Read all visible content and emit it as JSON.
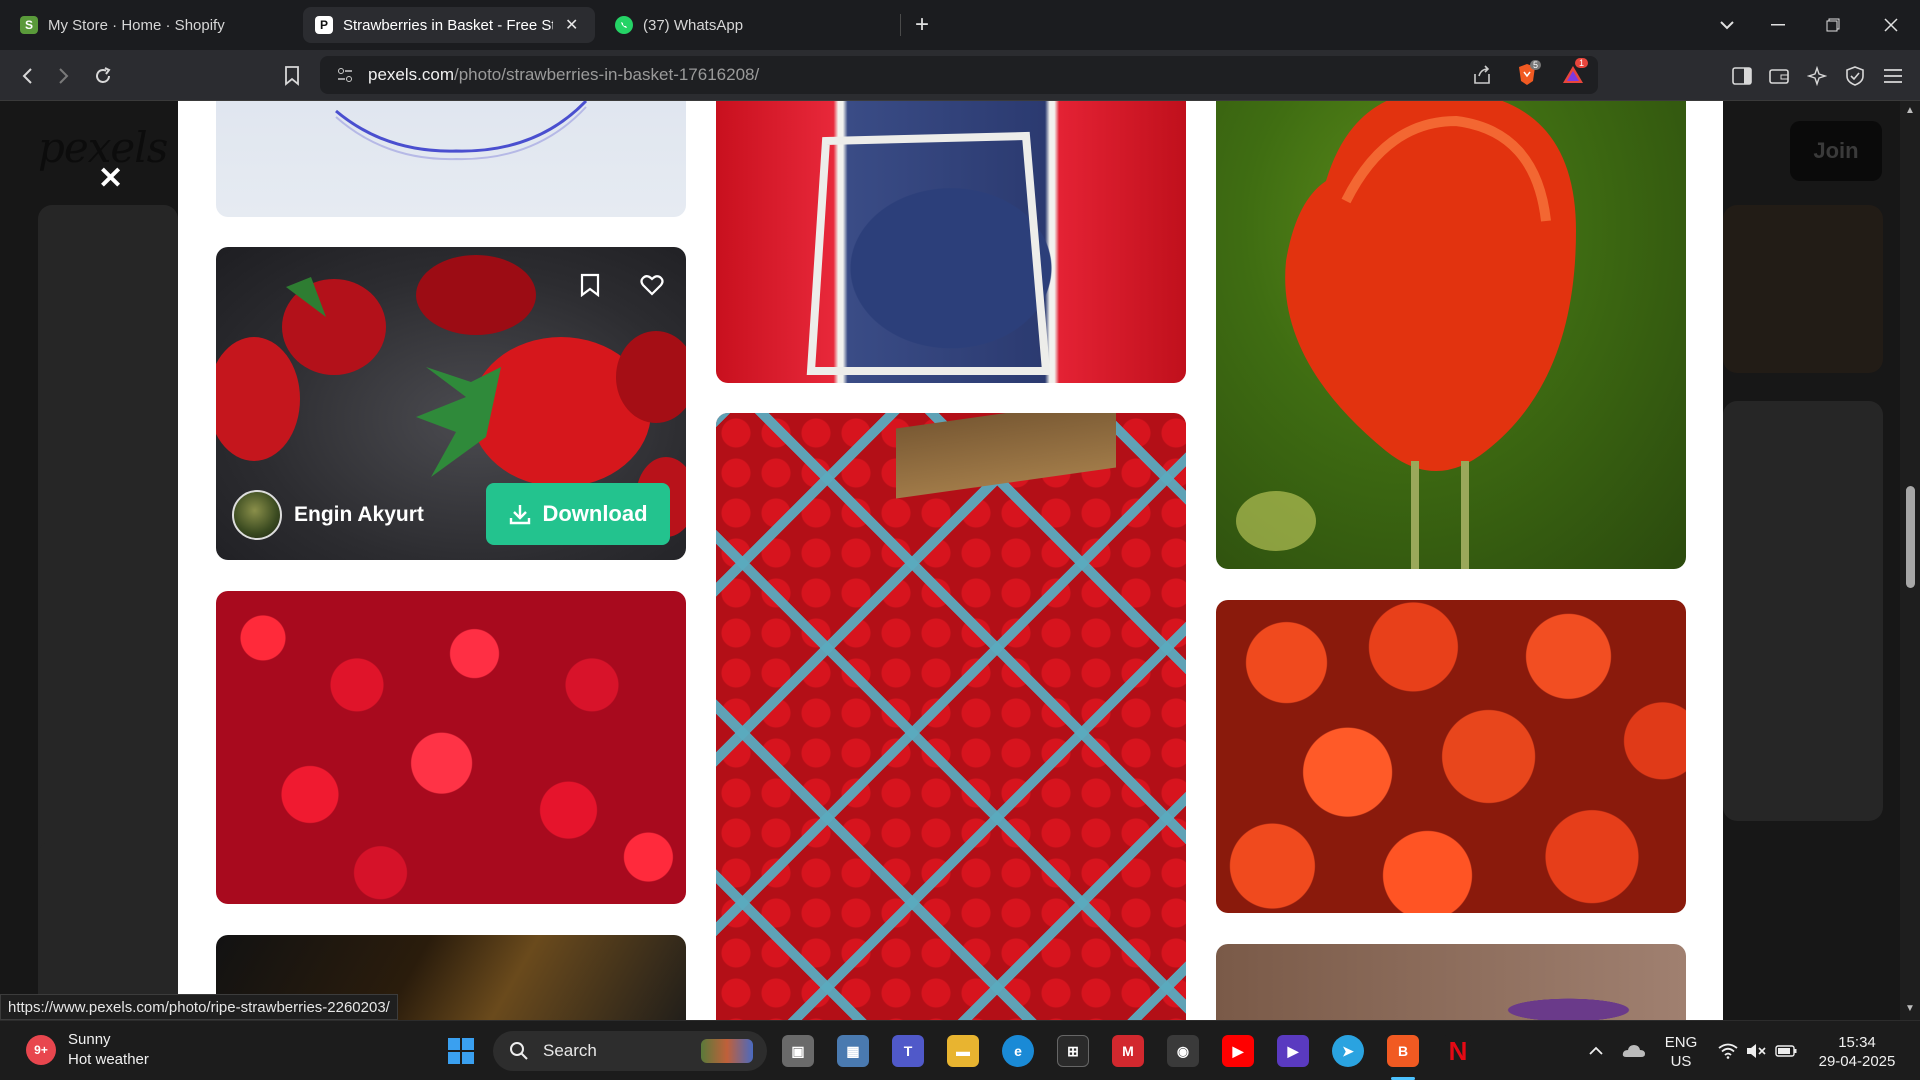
{
  "browser": {
    "tabs": [
      {
        "title": "My Store · Home · Shopify",
        "favicon": "shopify-icon",
        "active": false
      },
      {
        "title": "Strawberries in Basket - Free Sto",
        "favicon": "pexels-icon",
        "active": true
      },
      {
        "title": "(37) WhatsApp",
        "favicon": "whatsapp-icon",
        "active": false
      }
    ],
    "url_host": "pexels.com",
    "url_path": "/photo/strawberries-in-basket-17616208/",
    "brave_shield_count": "5",
    "rewards_badge": "1"
  },
  "page": {
    "logo": "pexels",
    "join_label": "Join",
    "author_name": "Engin Akyurt",
    "download_label": "Download",
    "status_url": "https://www.pexels.com/photo/ripe-strawberries-2260203/"
  },
  "taskbar": {
    "weather_title": "Sunny",
    "weather_desc": "Hot weather",
    "weather_badge": "9+",
    "search_label": "Search",
    "lang_top": "ENG",
    "lang_bottom": "US",
    "time": "15:34",
    "date": "29-04-2025"
  },
  "colors": {
    "download_green": "#23c38e",
    "chrome_dark": "#1b1c1f"
  }
}
